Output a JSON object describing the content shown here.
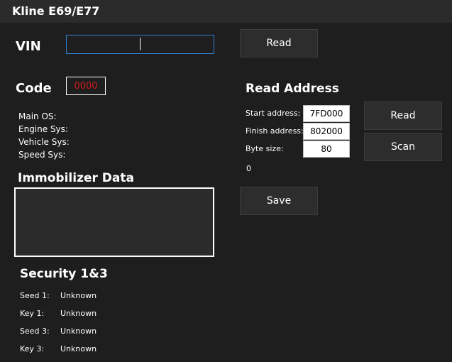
{
  "window": {
    "title": "Kline E69/E77"
  },
  "vin": {
    "label": "VIN",
    "value": "",
    "read_label": "Read"
  },
  "code": {
    "label": "Code",
    "value": "0000"
  },
  "sysinfo": {
    "items": [
      {
        "label": "Main OS:"
      },
      {
        "label": "Engine Sys:"
      },
      {
        "label": "Vehicle Sys:"
      },
      {
        "label": "Speed Sys:"
      }
    ]
  },
  "immobilizer": {
    "title": "Immobilizer Data",
    "value": ""
  },
  "security": {
    "title": "Security 1&3",
    "rows": [
      {
        "label": "Seed 1:",
        "value": "Unknown"
      },
      {
        "label": "Key 1:",
        "value": "Unknown"
      },
      {
        "label": "Seed 3:",
        "value": "Unknown"
      },
      {
        "label": "Key 3:",
        "value": "Unknown"
      }
    ]
  },
  "read_address": {
    "title": "Read Address",
    "start_label": "Start address:",
    "start_value": "7FD000",
    "finish_label": "Finish address:",
    "finish_value": "802000",
    "size_label": "Byte size:",
    "size_value": "80",
    "progress_text": "0",
    "read_label": "Read",
    "scan_label": "Scan",
    "save_label": "Save"
  }
}
